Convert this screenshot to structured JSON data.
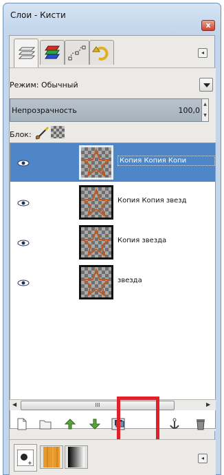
{
  "window": {
    "title": "Слои - Кисти",
    "close_glyph": "x"
  },
  "tabs": [
    "layers-tab",
    "channels-tab",
    "paths-tab",
    "undo-tab"
  ],
  "mode": {
    "label": "Режим: Обычный"
  },
  "opacity": {
    "label": "Непрозрачность",
    "value": "100,0"
  },
  "lock": {
    "label": "Блок:"
  },
  "layers": [
    {
      "name": "Копия Копия Копи",
      "selected": true
    },
    {
      "name": "Копия Копия звезд",
      "selected": false
    },
    {
      "name": "Копия звезда",
      "selected": false
    },
    {
      "name": "звезда",
      "selected": false
    }
  ],
  "scrollbar": {
    "thumb_glyph": "III"
  },
  "toolbar_icons": [
    "new-layer-icon",
    "new-group-icon",
    "raise-layer-icon",
    "lower-layer-icon",
    "duplicate-layer-icon",
    "anchor-icon",
    "delete-icon"
  ],
  "colors": {
    "selection": "#4f86c7",
    "highlight": "#e22027"
  }
}
